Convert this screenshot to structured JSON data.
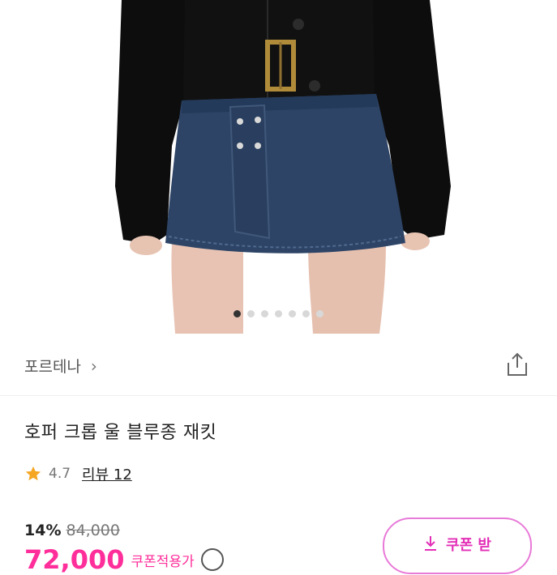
{
  "product_image": {
    "description": "product-photo",
    "carousel_total": 7,
    "carousel_active": 1
  },
  "brand": {
    "name": "포르테나",
    "chevron": "chevron-right-icon",
    "share_icon": "share-icon"
  },
  "product": {
    "title": "호퍼 크롭 울 블루종 재킷"
  },
  "rating": {
    "icon": "star-icon",
    "score": "4.7",
    "reviews_label": "리뷰 12"
  },
  "price": {
    "discount": "14%",
    "original": "84,000",
    "sale": "72,000",
    "sale_note": "쿠폰적용가"
  },
  "coupon_button": {
    "icon": "download-icon",
    "label": "쿠폰 받"
  },
  "colors": {
    "accent": "#ff2e9a",
    "coupon_border": "#e87ad8",
    "star": "#f5a623"
  }
}
